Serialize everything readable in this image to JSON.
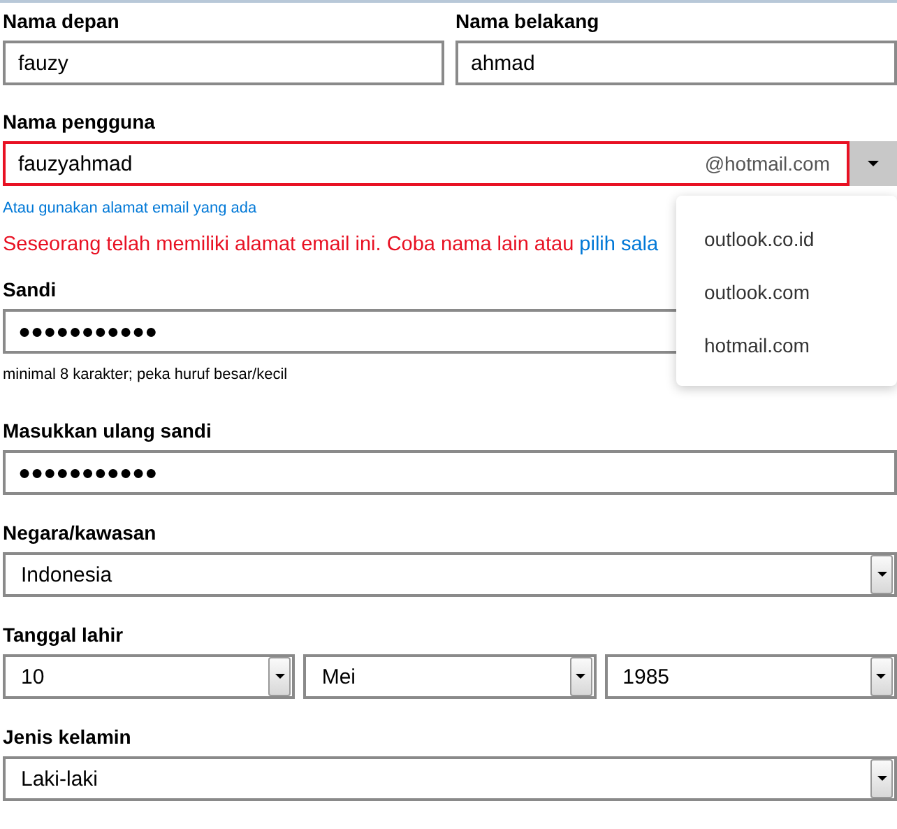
{
  "first_name": {
    "label": "Nama depan",
    "value": "fauzy"
  },
  "last_name": {
    "label": "Nama belakang",
    "value": "ahmad"
  },
  "username": {
    "label": "Nama pengguna",
    "value": "fauzyahmad",
    "domain": "@hotmail.com",
    "invalid": true,
    "dropdown_expanded": true
  },
  "existing_email_link": "Atau gunakan alamat email yang ada",
  "error": {
    "text": "Seseorang telah memiliki alamat email ini. Coba nama lain atau ",
    "link": "pilih sala"
  },
  "domain_options": [
    {
      "label": "outlook.co.id"
    },
    {
      "label": "outlook.com"
    },
    {
      "label": "hotmail.com"
    }
  ],
  "password": {
    "label": "Sandi",
    "value": "●●●●●●●●●●●",
    "hint": "minimal 8 karakter; peka huruf besar/kecil"
  },
  "password_repeat": {
    "label": "Masukkan ulang sandi",
    "value": "●●●●●●●●●●●"
  },
  "country": {
    "label": "Negara/kawasan",
    "value": "Indonesia"
  },
  "birth_date": {
    "label": "Tanggal lahir",
    "day": "10",
    "month": "Mei",
    "year": "1985"
  },
  "gender": {
    "label": "Jenis kelamin",
    "value": "Laki-laki"
  }
}
